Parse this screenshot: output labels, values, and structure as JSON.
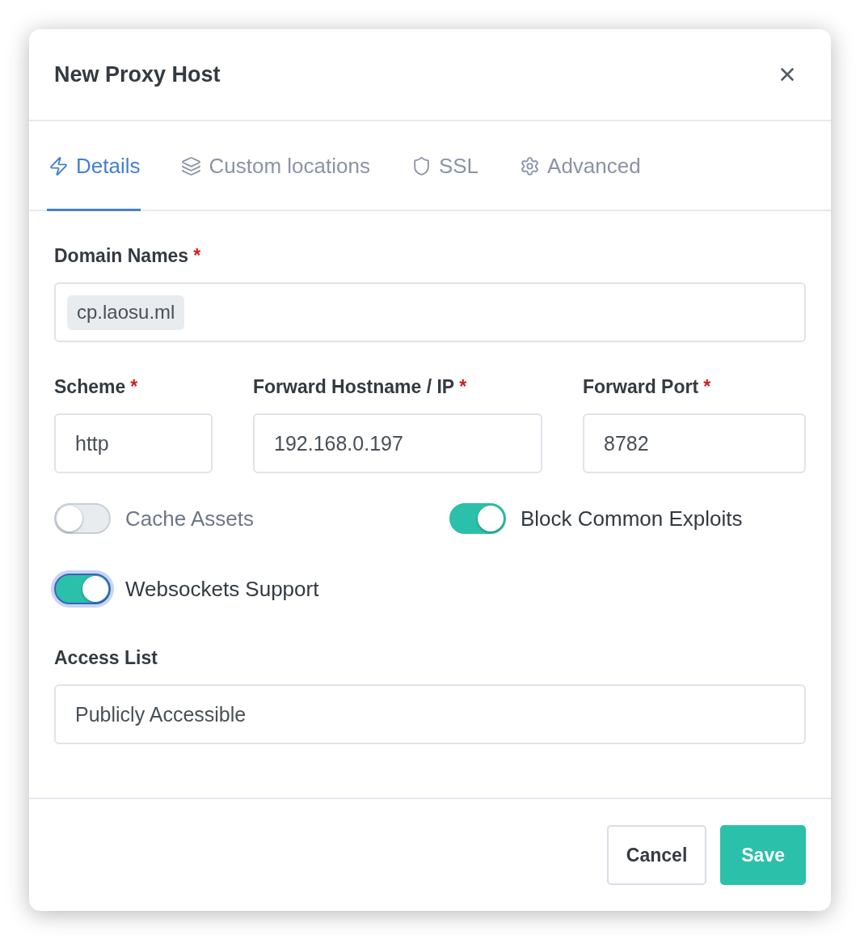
{
  "dialog": {
    "title": "New Proxy Host"
  },
  "tabs": [
    {
      "label": "Details",
      "selected": true
    },
    {
      "label": "Custom locations",
      "selected": false
    },
    {
      "label": "SSL",
      "selected": false
    },
    {
      "label": "Advanced",
      "selected": false
    }
  ],
  "domain_names": {
    "label": "Domain Names",
    "required_mark": "*",
    "tags": [
      "cp.laosu.ml"
    ]
  },
  "forward_fields": [
    {
      "label": "Scheme",
      "required_mark": "*",
      "value": "http"
    },
    {
      "label": "Forward Hostname / IP",
      "required_mark": "*",
      "value": "192.168.0.197"
    },
    {
      "label": "Forward Port",
      "required_mark": "*",
      "value": "8782"
    }
  ],
  "toggles": [
    {
      "label": "Cache Assets",
      "on": false,
      "focused": false
    },
    {
      "label": "Block Common Exploits",
      "on": true,
      "focused": false
    },
    {
      "label": "Websockets Support",
      "on": true,
      "focused": true
    }
  ],
  "access_list": {
    "label": "Access List",
    "value": "Publicly Accessible"
  },
  "buttons": [
    {
      "label": "Cancel",
      "kind": "secondary"
    },
    {
      "label": "Save",
      "kind": "primary"
    }
  ]
}
